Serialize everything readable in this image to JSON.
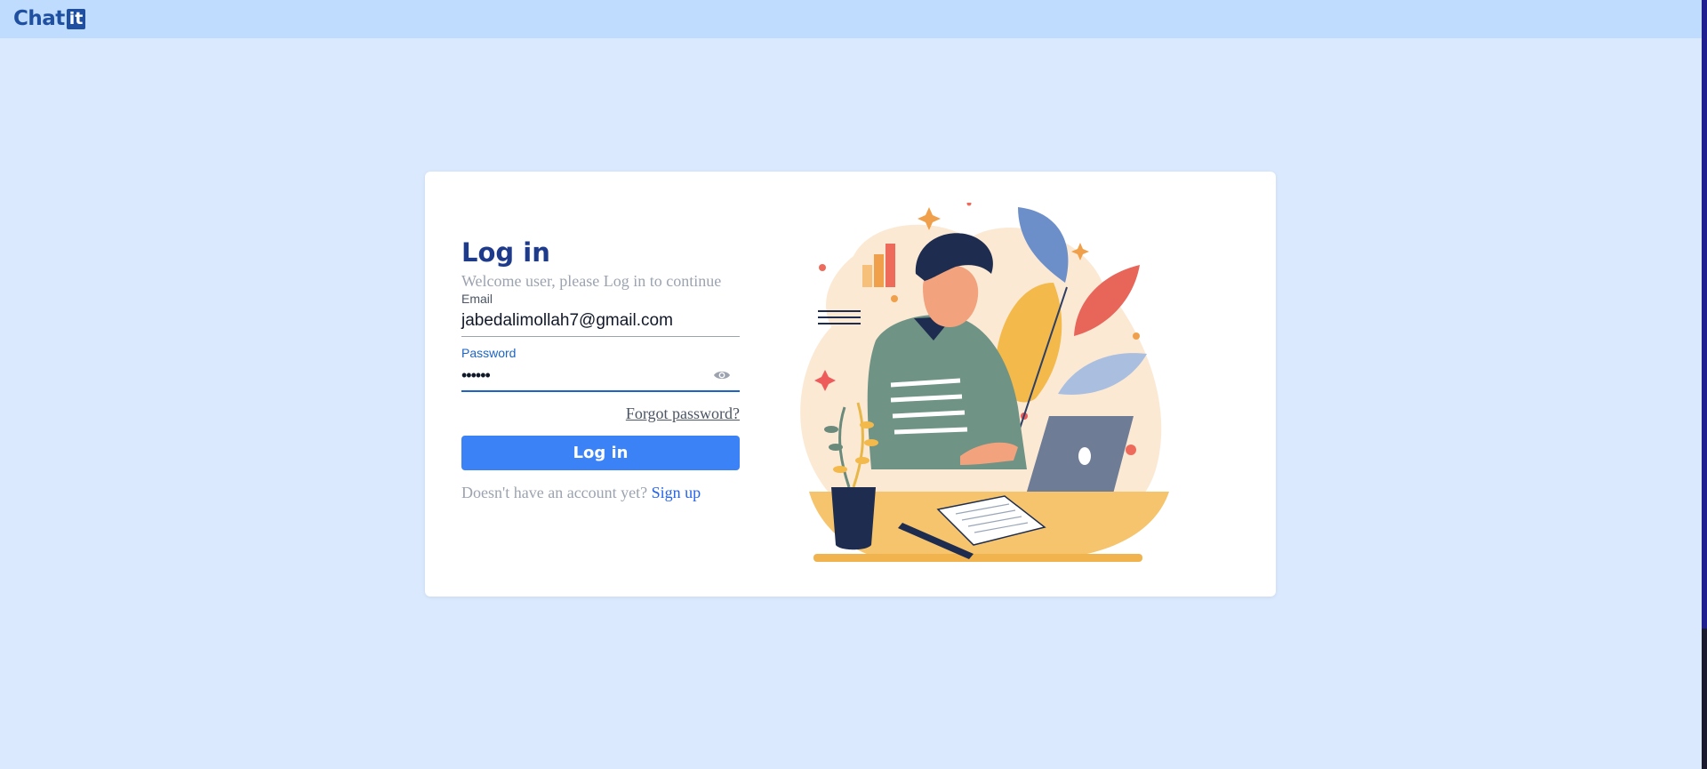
{
  "app": {
    "logo_text": "Chat",
    "logo_badge": "it"
  },
  "login": {
    "title": "Log in",
    "subtitle": "Welcome user, please Log in to continue",
    "email_label": "Email",
    "email_value": "jabedalimollah7@gmail.com",
    "password_label": "Password",
    "password_value": "••••••",
    "forgot_label": "Forgot password?",
    "button_label": "Log in",
    "signup_prompt": "Doesn't have an account yet?",
    "signup_link": "Sign up"
  },
  "icons": {
    "password_toggle": "eye-icon"
  },
  "colors": {
    "page_bg": "#dbe9fe",
    "topbar_bg": "#bfdbfe",
    "brand": "#1e4fa0",
    "title": "#1e3a8a",
    "button": "#3b82f6",
    "focus": "#1d64c4",
    "link": "#2563eb"
  }
}
